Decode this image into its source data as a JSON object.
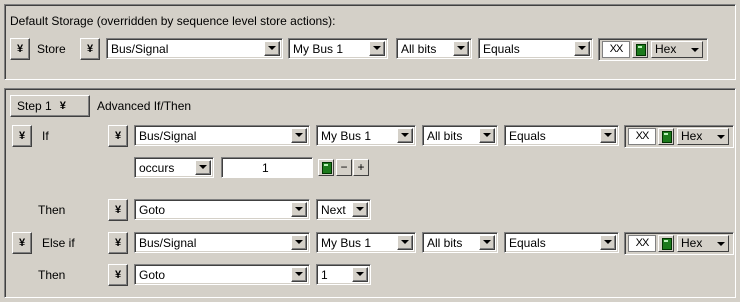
{
  "default_storage": {
    "heading": "Default Storage (overridden by sequence level store actions):",
    "store_label": "Store",
    "source": "Bus/Signal",
    "bus": "My Bus 1",
    "bits": "All bits",
    "operator": "Equals",
    "value": "XX",
    "radix": "Hex"
  },
  "step": {
    "step_label": "Step 1",
    "mode_label": "Advanced If/Then",
    "if": {
      "label": "If",
      "source": "Bus/Signal",
      "bus": "My Bus 1",
      "bits": "All bits",
      "operator": "Equals",
      "value": "XX",
      "radix": "Hex",
      "occurs": "occurs",
      "count": "1",
      "minus": "−",
      "plus": "+"
    },
    "then1": {
      "label": "Then",
      "action": "Goto",
      "target": "Next"
    },
    "elseif": {
      "label": "Else if",
      "source": "Bus/Signal",
      "bus": "My Bus 1",
      "bits": "All bits",
      "operator": "Equals",
      "value": "XX",
      "radix": "Hex"
    },
    "then2": {
      "label": "Then",
      "action": "Goto",
      "target": "1"
    }
  },
  "icons": {
    "chevron": "double-chevron-down-icon",
    "calculator": "calculator-icon",
    "dropdown": "dropdown-arrow-icon"
  }
}
